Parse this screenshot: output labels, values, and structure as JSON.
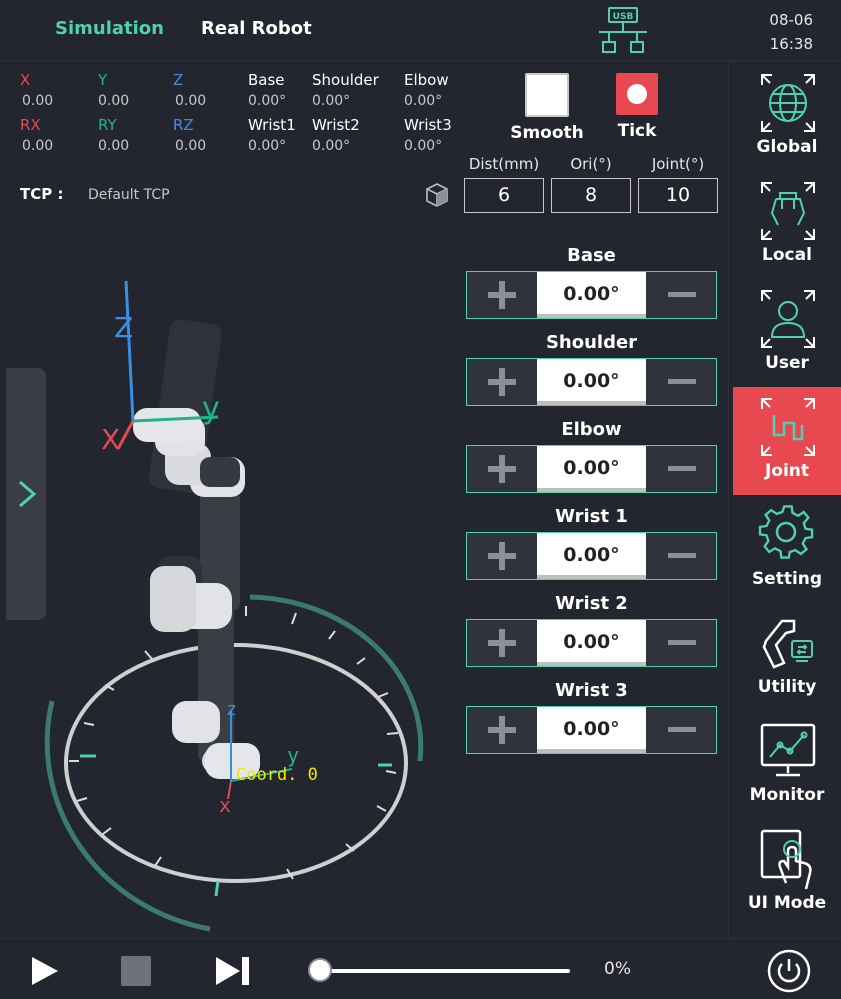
{
  "header": {
    "tabs": [
      {
        "label": "Simulation"
      },
      {
        "label": "Real Robot"
      }
    ],
    "usb_label": "USB",
    "date": "08-06",
    "time": "16:38"
  },
  "coords": {
    "labels": [
      "X",
      "Y",
      "Z",
      "Base",
      "Shoulder",
      "Elbow",
      "RX",
      "RY",
      "RZ",
      "Wrist1",
      "Wrist2",
      "Wrist3"
    ],
    "values": [
      "0.00",
      "0.00",
      "0.00",
      "0.00°",
      "0.00°",
      "0.00°",
      "0.00",
      "0.00",
      "0.00",
      "0.00°",
      "0.00°",
      "0.00°"
    ]
  },
  "toggles": {
    "smooth_label": "Smooth",
    "tick_label": "Tick"
  },
  "tcp": {
    "label": "TCP :",
    "value": "Default TCP"
  },
  "step": {
    "dist_label": "Dist(mm)",
    "ori_label": "Ori(°)",
    "joint_label": "Joint(°)",
    "dist_value": "6",
    "ori_value": "8",
    "joint_value": "10"
  },
  "joints": [
    {
      "name": "Base",
      "value": "0.00°"
    },
    {
      "name": "Shoulder",
      "value": "0.00°"
    },
    {
      "name": "Elbow",
      "value": "0.00°"
    },
    {
      "name": "Wrist 1",
      "value": "0.00°"
    },
    {
      "name": "Wrist 2",
      "value": "0.00°"
    },
    {
      "name": "Wrist 3",
      "value": "0.00°"
    }
  ],
  "viewport": {
    "axis_z_top": "Z",
    "axis_y_top": "y",
    "axis_x_top": "X",
    "axis_z_base": "z",
    "axis_y_base": "y",
    "axis_x_base": "x",
    "coord_label": "Coord. 0"
  },
  "sidebar": {
    "items": [
      {
        "label": "Global",
        "icon": "globe-icon"
      },
      {
        "label": "Local",
        "icon": "gripper-icon"
      },
      {
        "label": "User",
        "icon": "user-icon"
      },
      {
        "label": "Joint",
        "icon": "joint-icon"
      },
      {
        "label": "Setting",
        "icon": "gear-icon"
      },
      {
        "label": "Utility",
        "icon": "utility-icon"
      },
      {
        "label": "Monitor",
        "icon": "monitor-icon"
      },
      {
        "label": "UI Mode",
        "icon": "touch-icon"
      }
    ],
    "active": "Joint"
  },
  "playback": {
    "progress_percent": 0,
    "progress_label": "0%"
  },
  "colors": {
    "background": "#23262e",
    "accent": "#4fd1b0",
    "active": "#e8484f",
    "axis_x": "#e8484f",
    "axis_y": "#1fb38a",
    "axis_z": "#3a8ee6"
  }
}
